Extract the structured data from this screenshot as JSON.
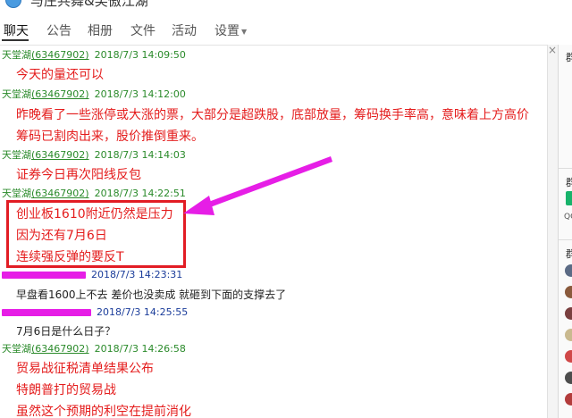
{
  "window": {
    "title": "与庄共舞&笑傲江湖"
  },
  "tabs": [
    "聊天",
    "公告",
    "相册",
    "文件",
    "活动",
    "设置"
  ],
  "colors": {
    "accent_red": "#e41c1c",
    "sender_green": "#2a8a2a",
    "highlight_box": "#e21c24",
    "arrow_magenta": "#e61ee6"
  },
  "messages": [
    {
      "sender": "天堂湖",
      "qq": "(63467902)",
      "time": "2018/7/3 14:09:50",
      "lines": [
        "今天的量还可以"
      ]
    },
    {
      "sender": "天堂湖",
      "qq": "(63467902)",
      "time": "2018/7/3 14:12:00",
      "lines": [
        "昨晚看了一些涨停或大涨的票，大部分是超跌股，底部放量，筹码换手率高，意味着上方高价",
        "筹码已割肉出来，股价推倒重来。"
      ]
    },
    {
      "sender": "天堂湖",
      "qq": "(63467902)",
      "time": "2018/7/3 14:14:03",
      "lines": [
        "证券今日再次阳线反包"
      ]
    },
    {
      "sender": "天堂湖",
      "qq": "(63467902)",
      "time": "2018/7/3 14:22:51",
      "lines": [
        "创业板1610附近仍然是压力",
        "因为还有7月6日",
        "连续强反弹的要反T"
      ]
    },
    {
      "time": "2018/7/3 14:23:31",
      "lines": [
        "早盘看1600上不去 差价也没卖成 就砸到下面的支撑去了"
      ]
    },
    {
      "time": "2018/7/3 14:25:55",
      "lines": [
        "7月6日是什么日子？"
      ]
    },
    {
      "sender": "天堂湖",
      "qq": "(63467902)",
      "time": "2018/7/3 14:26:58",
      "lines": [
        "贸易战征税清单结果公布",
        "特朗普打的贸易战",
        "虽然这个预期的利空在提前消化"
      ]
    }
  ],
  "sidebar": {
    "label_top": "群",
    "label_mid": "群",
    "qq_label": "QQ",
    "label_bottom": "群"
  }
}
